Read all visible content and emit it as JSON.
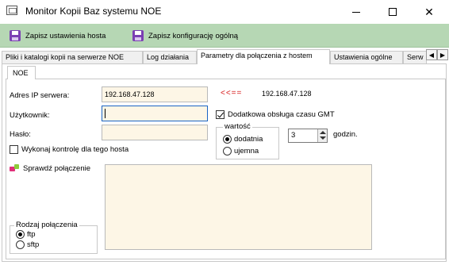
{
  "window": {
    "title": "Monitor Kopii Baz systemu NOE",
    "minimize_glyph": "",
    "maximize_glyph": "",
    "close_glyph": "✕"
  },
  "toolbar": {
    "save_settings_label": "Zapisz ustawienia hosta",
    "save_config_label": "Zapisz konfigurację ogólną"
  },
  "tabs": [
    {
      "label": "Pliki i katalogi kopii na serwerze NOE"
    },
    {
      "label": "Log działania"
    },
    {
      "label": "Parametry dla połączenia z hostem"
    },
    {
      "label": "Ustawienia ogólne"
    },
    {
      "label": "Serw"
    }
  ],
  "tab_scroll": {
    "left": "◀",
    "right": "▶"
  },
  "subtab": {
    "label": "NOE"
  },
  "form": {
    "server_ip_label": "Adres IP serwera:",
    "server_ip_value": "192.168.47.128",
    "arrow_indicator": "<<==",
    "server_ip_echo": "192.168.47.128",
    "user_label": "Użytkownik:",
    "user_value": "",
    "password_label": "Hasło:",
    "password_value": "",
    "gmt_label": "Dodatkowa obsługa czasu GMT",
    "gmt_checked": true,
    "control_label": "Wykonaj kontrolę dla tego hosta",
    "control_checked": false,
    "value_group_title": "wartość",
    "positive_label": "dodatnia",
    "negative_label": "ujemna",
    "selected_sign": "dodatnia",
    "hours_value": "3",
    "hours_label": "godzin.",
    "check_connection_label": "Sprawdź połączenie",
    "result_text": ""
  },
  "connection": {
    "group_title": "Rodzaj połączenia",
    "options": [
      "ftp",
      "sftp"
    ],
    "selected": "ftp"
  },
  "colors": {
    "toolbar_bg": "#b6d7b4",
    "field_bg": "#fdf6e6",
    "indicator_red": "#d81b1b",
    "focus_blue": "#1a64c4"
  }
}
